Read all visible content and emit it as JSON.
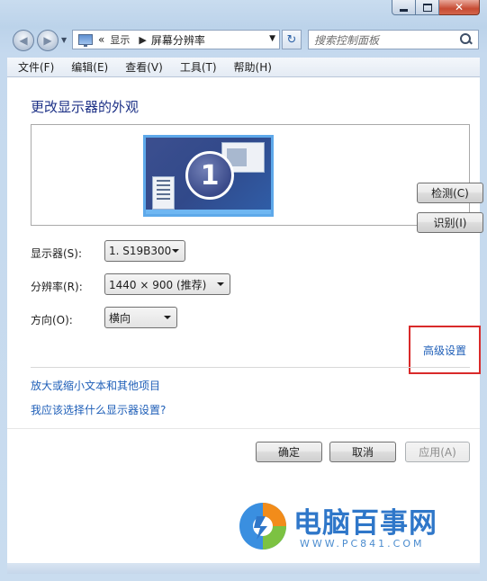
{
  "window": {
    "caption": {
      "minimize": "",
      "maximize": "",
      "close": "✕"
    }
  },
  "nav": {
    "back_glyph": "◀",
    "forward_glyph": "▶",
    "history_glyph": "▼",
    "breadcrumb_prefix": "«",
    "breadcrumb": [
      "显示",
      "屏幕分辨率"
    ],
    "breadcrumb_sep": "▶",
    "address_dropdown": "▼",
    "refresh_glyph": "↻",
    "search_placeholder": "搜索控制面板"
  },
  "menubar": {
    "items": [
      "文件(F)",
      "编辑(E)",
      "查看(V)",
      "工具(T)",
      "帮助(H)"
    ]
  },
  "main": {
    "heading": "更改显示器的外观",
    "monitor_number": "1",
    "detect_button": "检测(C)",
    "identify_button": "识别(I)",
    "display": {
      "label": "显示器(S):",
      "value": "1. S19B300"
    },
    "resolution": {
      "label": "分辨率(R):",
      "value": "1440 × 900 (推荐)"
    },
    "orientation": {
      "label": "方向(O):",
      "value": "横向"
    },
    "advanced_link": "高级设置",
    "link_text_size": "放大或缩小文本和其他项目",
    "link_which_settings": "我应该选择什么显示器设置?",
    "ok_button": "确定",
    "cancel_button": "取消",
    "apply_button": "应用(A)"
  },
  "watermark": {
    "title": "电脑百事网",
    "url": "WWW.PC841.COM"
  },
  "colors": {
    "link": "#1f5fb8",
    "heading": "#1e3287",
    "highlight_box": "#d92a2a",
    "monitor_border": "#5ea9ea"
  }
}
